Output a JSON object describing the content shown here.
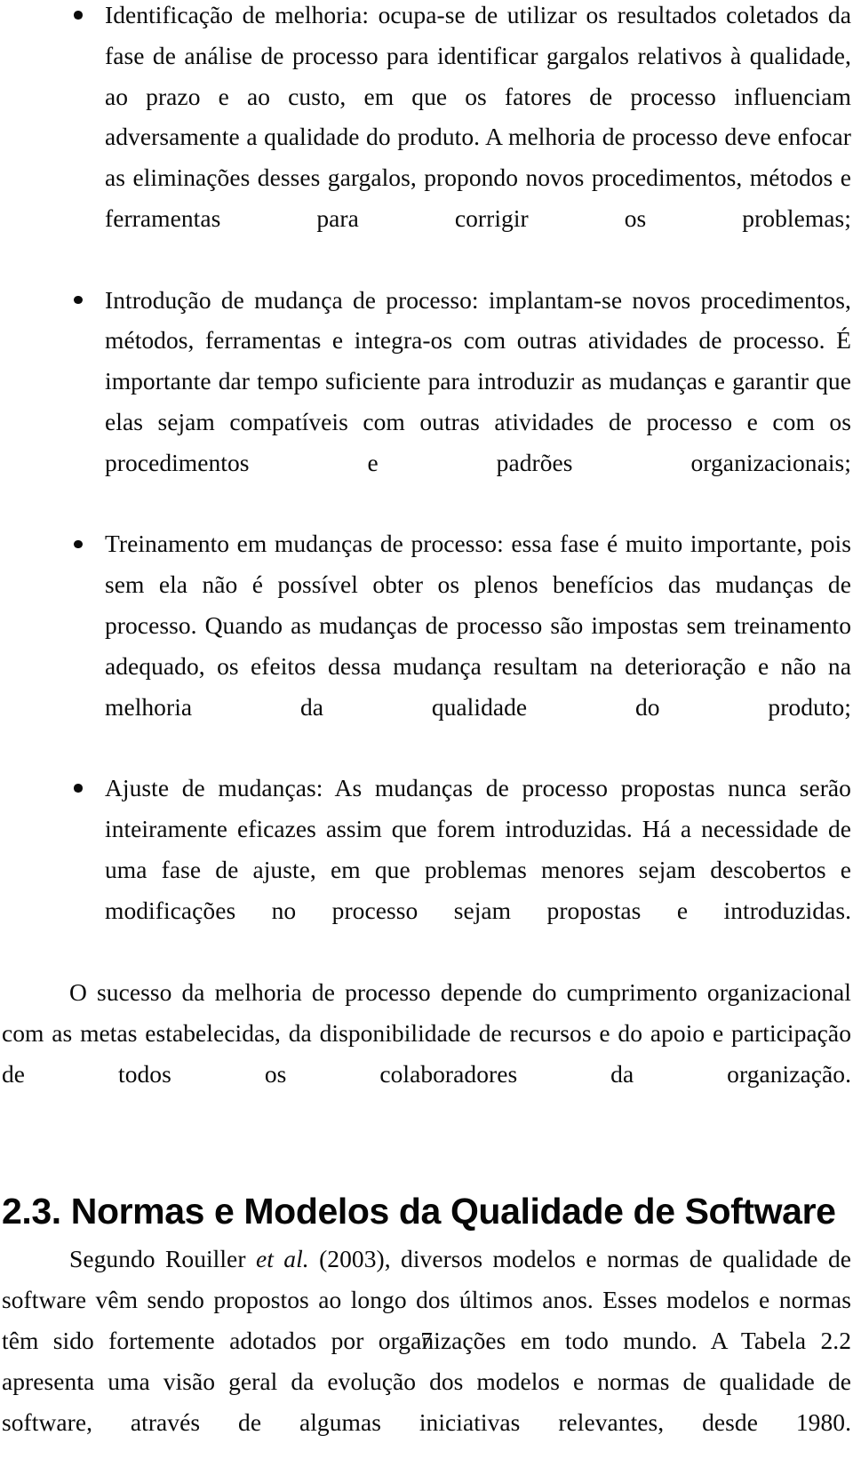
{
  "document": {
    "page_number": "7",
    "bullet_glyph": "•",
    "text_color": "#0b0b0b",
    "background_color": "#ffffff"
  },
  "bullets": [
    {
      "name": "identificacao-de-melhoria",
      "text": "Identificação de melhoria: ocupa-se de utilizar os resultados coletados da fase de análise de processo para identificar gargalos relativos à qualidade, ao prazo e ao custo, em que os fatores de processo influenciam adversamente a qualidade do produto. A melhoria de processo deve enfocar as eliminações desses gargalos, propondo novos procedimentos, métodos e ferramentas para corrigir os problemas;"
    },
    {
      "name": "introducao-de-mudanca-de-processo",
      "text": "Introdução de mudança de processo: implantam-se novos procedimentos, métodos, ferramentas e integra-os com outras atividades de processo. É importante dar tempo suficiente para introduzir as mudanças e garantir que elas sejam compatíveis com outras atividades de processo e com os procedimentos e padrões organizacionais;"
    },
    {
      "name": "treinamento-em-mudancas-de-processo",
      "text": "Treinamento em mudanças de processo: essa fase é muito importante, pois sem ela não é possível obter os plenos benefícios das mudanças de processo. Quando as mudanças de processo são impostas sem treinamento adequado, os efeitos dessa mudança resultam na deterioração e não na melhoria da qualidade do produto;"
    },
    {
      "name": "ajuste-de-mudancas",
      "text": "Ajuste de mudanças: As mudanças de processo propostas nunca serão inteiramente eficazes assim que forem introduzidas. Há a necessidade de uma fase de ajuste, em que problemas menores sejam descobertos e modificações no processo sejam propostas e introduzidas."
    }
  ],
  "paragraph_after_bullets": {
    "text": "O sucesso da melhoria de processo depende do cumprimento organizacional com as metas estabelecidas, da disponibilidade de recursos e do apoio e participação de todos os colaboradores da organização."
  },
  "section": {
    "heading": "2.3. Normas e Modelos da Qualidade de Software",
    "paragraph_part_1": "Segundo Rouiller ",
    "paragraph_italic": "et al.",
    "paragraph_part_2": " (2003), diversos modelos e normas de qualidade de software vêm sendo propostos ao longo dos últimos anos. Esses modelos e normas têm sido fortemente adotados por organizações em todo mundo. A Tabela 2.2 apresenta uma visão geral da evolução dos modelos e normas de qualidade de software, através de algumas iniciativas relevantes, desde 1980."
  }
}
